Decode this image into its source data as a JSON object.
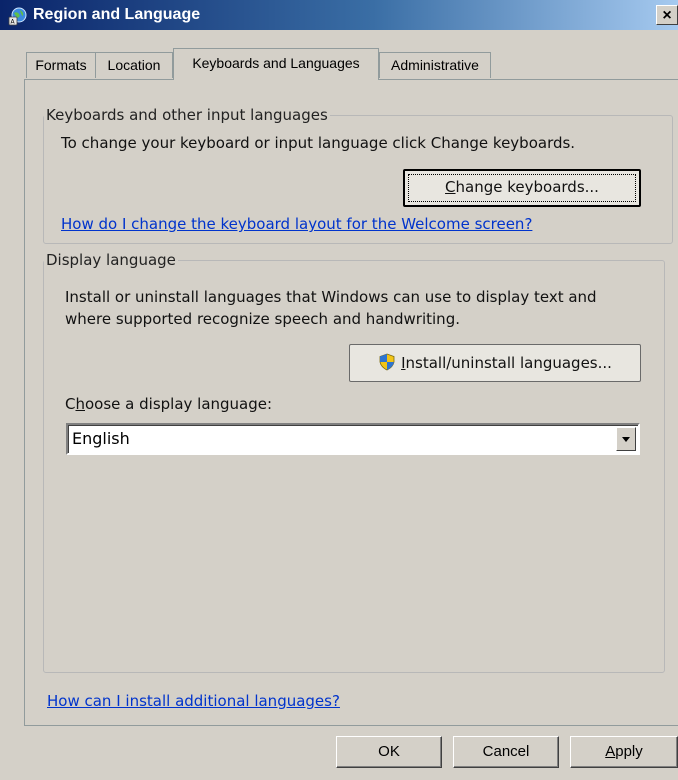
{
  "window": {
    "title": "Region and Language",
    "close_label": "×"
  },
  "tabs": [
    {
      "label": "Formats",
      "active": false
    },
    {
      "label": "Location",
      "active": false
    },
    {
      "label": "Keyboards and Languages",
      "active": true
    },
    {
      "label": "Administrative",
      "active": false
    }
  ],
  "keyboards_group": {
    "legend": "Keyboards and other input languages",
    "description": "To change your keyboard or input language click Change keyboards.",
    "change_button": {
      "mnemonic": "C",
      "rest": "hange keyboards..."
    },
    "welcome_link": "How do I change the keyboard layout for the Welcome screen?"
  },
  "display_group": {
    "legend": "Display language",
    "description_line1": "Install or uninstall languages that Windows can use to display text and",
    "description_line2": "where supported recognize speech and handwriting.",
    "install_button": {
      "mnemonic": "I",
      "rest": "nstall/uninstall languages..."
    },
    "choose_label": {
      "before": "C",
      "mnemonic": "h",
      "after": "oose a display language:"
    },
    "selected_language": "English"
  },
  "additional_languages_link": "How can I install additional languages?",
  "footer": {
    "ok_label": "OK",
    "cancel_label": "Cancel",
    "apply": {
      "mnemonic": "A",
      "rest": "pply"
    }
  },
  "colors": {
    "title_bar_start": "#0a246a",
    "title_bar_end": "#a6caf0",
    "link": "#0033cc"
  }
}
